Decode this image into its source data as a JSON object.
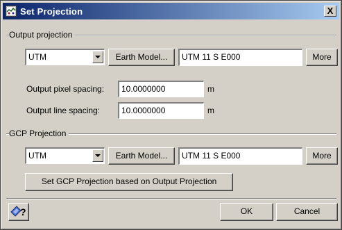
{
  "window": {
    "title": "Set Projection",
    "icon": "projection-app-icon",
    "close_label": "X"
  },
  "output_projection": {
    "group_label": "Output projection",
    "projection_select": "UTM",
    "earth_model_label": "Earth Model...",
    "projection_value": "UTM    11 S E000",
    "more_label": "More",
    "pixel_spacing_label": "Output pixel spacing:",
    "pixel_spacing_value": "10.0000000",
    "pixel_spacing_unit": "m",
    "line_spacing_label": "Output line spacing:",
    "line_spacing_value": "10.0000000",
    "line_spacing_unit": "m"
  },
  "gcp_projection": {
    "group_label": "GCP Projection",
    "projection_select": "UTM",
    "earth_model_label": "Earth Model...",
    "projection_value": "UTM    11 S E000",
    "more_label": "More",
    "set_from_output_label": "Set GCP Projection based on Output Projection"
  },
  "footer": {
    "help_icon": "help-pointer-icon",
    "ok_label": "OK",
    "cancel_label": "Cancel"
  }
}
